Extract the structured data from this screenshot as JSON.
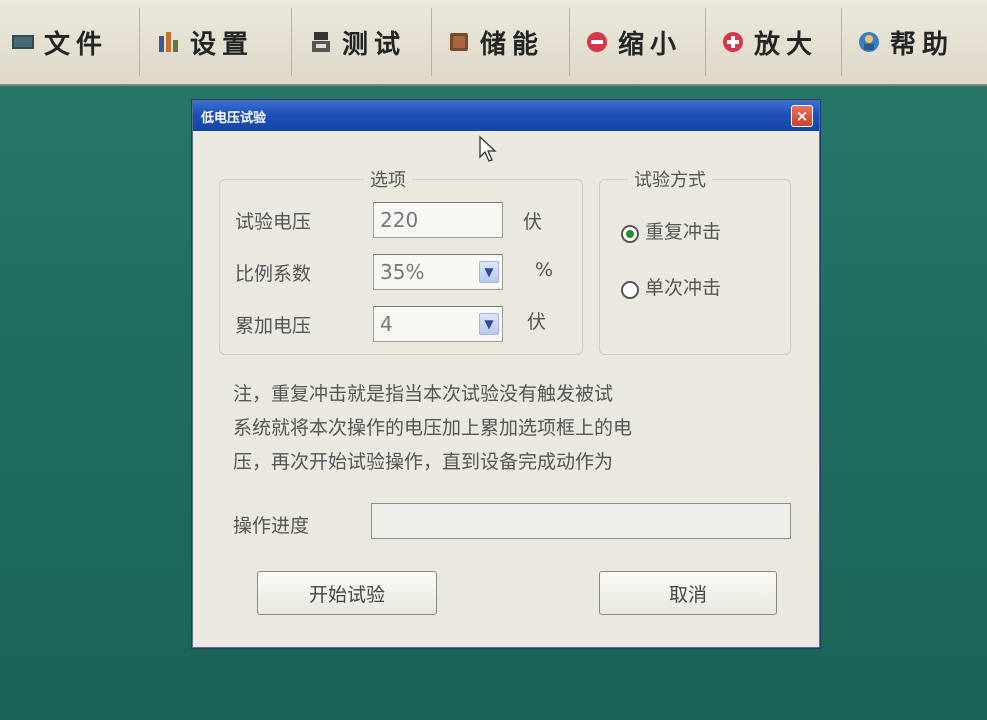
{
  "toolbar": {
    "items": [
      {
        "label": "文件",
        "icon": "screen-icon"
      },
      {
        "label": "设置",
        "icon": "settings-icon"
      },
      {
        "label": "测试",
        "icon": "test-icon"
      },
      {
        "label": "储能",
        "icon": "book-icon"
      },
      {
        "label": "缩小",
        "icon": "minus-circle-icon"
      },
      {
        "label": "放大",
        "icon": "plus-circle-icon"
      },
      {
        "label": "帮助",
        "icon": "help-icon"
      }
    ]
  },
  "dialog": {
    "title": "低电压试验",
    "close_glyph": "×",
    "options": {
      "group_title": "选项",
      "voltage_label": "试验电压",
      "voltage_value": "220",
      "voltage_unit": "伏",
      "ratio_label": "比例系数",
      "ratio_value": "35%",
      "ratio_unit": "%",
      "add_label": "累加电压",
      "add_value": "4",
      "add_unit": "伏"
    },
    "mode": {
      "group_title": "试验方式",
      "repeat_label": "重复冲击",
      "single_label": "单次冲击",
      "selected": "重复冲击"
    },
    "note_lines": [
      "注，重复冲击就是指当本次试验没有触发被试",
      "系统就将本次操作的电压加上累加选项框上的电",
      "压，再次开始试验操作，直到设备完成动作为"
    ],
    "progress_label": "操作进度",
    "progress_fraction": 0,
    "start_button": "开始试验",
    "cancel_button": "取消"
  },
  "colors": {
    "desktop": "#1f6b5e",
    "titlebar": "#1e4fb8",
    "dialog_bg": "#ebe9df"
  }
}
